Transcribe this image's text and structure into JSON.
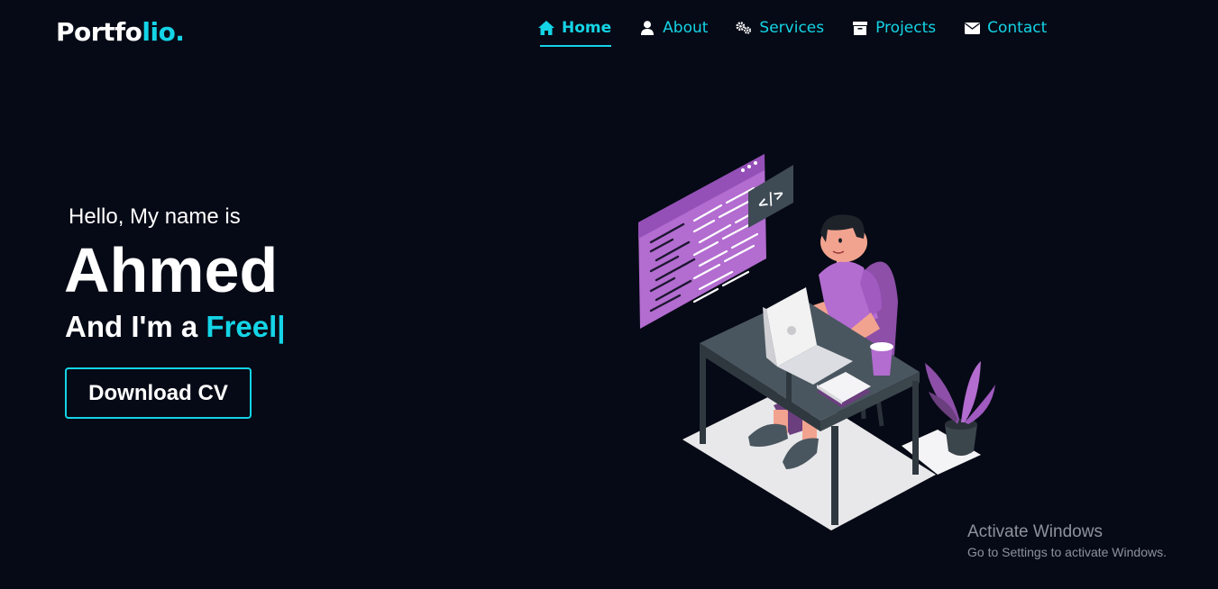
{
  "header": {
    "logo_main": "Portfo",
    "logo_accent": "lio."
  },
  "nav": {
    "items": [
      {
        "label": "Home",
        "icon": "home-icon",
        "active": true
      },
      {
        "label": "About",
        "icon": "user-icon",
        "active": false
      },
      {
        "label": "Services",
        "icon": "gears-icon",
        "active": false
      },
      {
        "label": "Projects",
        "icon": "archive-icon",
        "active": false
      },
      {
        "label": "Contact",
        "icon": "envelope-icon",
        "active": false
      }
    ]
  },
  "hero": {
    "greeting": "Hello, My name is",
    "name": "Ahmed",
    "role_prefix": "And I'm a ",
    "role_typed": "Freel|",
    "button_label": "Download CV"
  },
  "watermark": {
    "title": "Activate Windows",
    "subtitle": "Go to Settings to activate Windows."
  },
  "colors": {
    "background": "#060a16",
    "accent": "#14d4e6",
    "illustration_purple": "#b06ac8"
  }
}
